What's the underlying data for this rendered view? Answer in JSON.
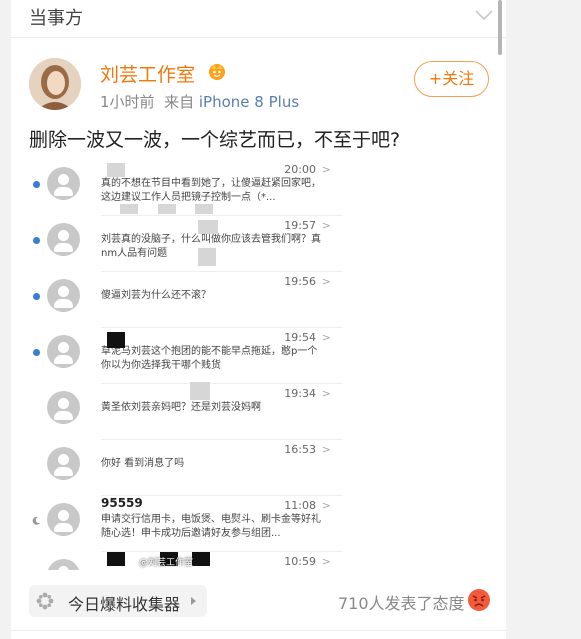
{
  "topbar": {
    "title": "当事方"
  },
  "author": {
    "name": "刘芸工作室",
    "time": "1小时前",
    "from": "来自",
    "device": "iPhone 8 Plus",
    "follow_label": "+关注"
  },
  "post": {
    "text": "删除一波又一波，一个综艺而已，不至于吧?"
  },
  "messages": [
    {
      "sender": "",
      "time": "20:00",
      "text": "真的不想在节目中看到她了，让傻逼赶紧回家吧，这边建议工作人员把镜子控制一点（*..."
    },
    {
      "sender": "",
      "time": "19:57",
      "text": "刘芸真的没脑子，什么叫做你应该去管我们啊？真nm人品有问题"
    },
    {
      "sender": "",
      "time": "19:56",
      "text": "傻逼刘芸为什么还不滚？"
    },
    {
      "sender": "",
      "time": "19:54",
      "text": "草泥马刘芸这个抱团的能不能早点拖延，憨p一个你以为你选择我干哪个贱货"
    },
    {
      "sender": "",
      "time": "19:34",
      "text": "黄圣依刘芸亲妈吧？还是刘芸没妈啊"
    },
    {
      "sender": "",
      "time": "16:53",
      "text": "你好 看到消息了吗"
    },
    {
      "sender": "95559",
      "time": "11:08",
      "text": "申请交行信用卡，电饭煲、电熨斗、刷卡金等好礼随心选！申卡成功后邀请好友参与组团..."
    },
    {
      "sender": "",
      "time": "10:59",
      "text": ""
    }
  ],
  "watermark": "@刘芸工作室",
  "footer": {
    "chip_label": "今日爆料收集器",
    "reaction_text": "710人发表了态度"
  },
  "colors": {
    "accent": "#f0780a",
    "link": "#5a7fb0",
    "unread_dot": "#3a7bd5"
  }
}
